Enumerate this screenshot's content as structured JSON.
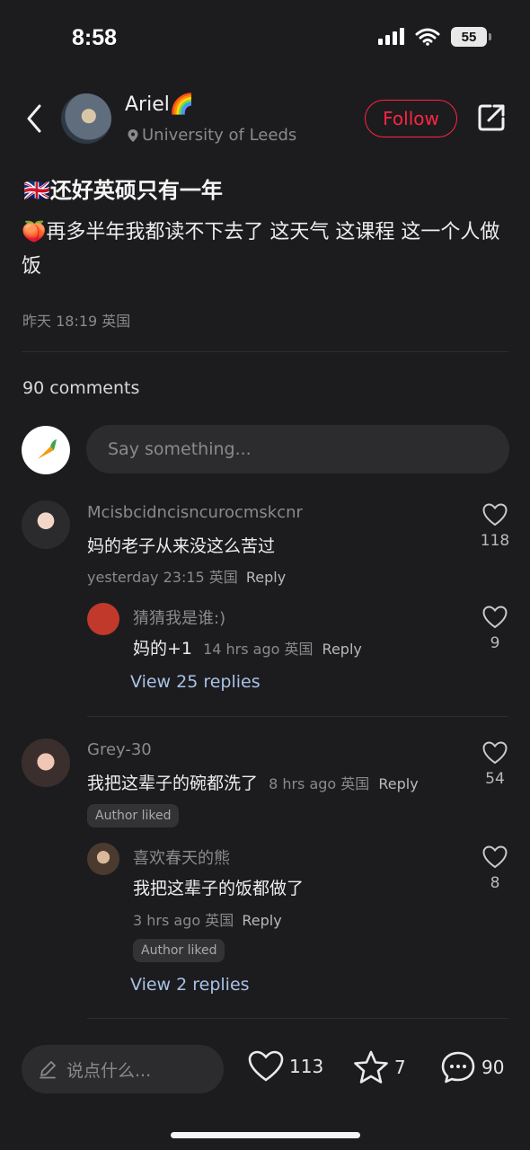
{
  "status_bar": {
    "time": "8:58",
    "battery": "55"
  },
  "author": {
    "name": "Ariel🌈",
    "location": "University of Leeds",
    "follow_label": "Follow"
  },
  "post": {
    "title": "🇬🇧还好英硕只有一年",
    "body": "🍑再多半年我都读不下去了 这天气 这课程 这一个人做饭",
    "meta": "昨天 18:19 英国"
  },
  "comments_section": {
    "count_label": "90 comments",
    "input_placeholder": "Say something..."
  },
  "comments": [
    {
      "name": "Mcisbcidncisncurocmskcnr",
      "text": "妈的老子从来没这么苦过",
      "meta": "yesterday 23:15 英国",
      "reply_label": "Reply",
      "likes": "118",
      "reply": {
        "name": "猜猜我是谁:)",
        "text": "妈的+1",
        "meta": "14 hrs ago 英国",
        "reply_label": "Reply",
        "likes": "9"
      },
      "view_replies": "View 25 replies"
    },
    {
      "name": "Grey-30",
      "text": "我把这辈子的碗都洗了",
      "meta": "8 hrs ago 英国",
      "reply_label": "Reply",
      "likes": "54",
      "badge": "Author liked",
      "reply": {
        "name": "喜欢春天的熊",
        "text": "我把这辈子的饭都做了",
        "meta": "3 hrs ago 英国",
        "reply_label": "Reply",
        "likes": "8",
        "badge": "Author liked"
      },
      "view_replies": "View 2 replies"
    }
  ],
  "bottom_bar": {
    "input_placeholder": "说点什么...",
    "likes": "113",
    "stars": "7",
    "comments": "90"
  },
  "colors": {
    "background": "#1c1c1e",
    "accent": "#ff2442",
    "link": "#a9c1e6"
  }
}
